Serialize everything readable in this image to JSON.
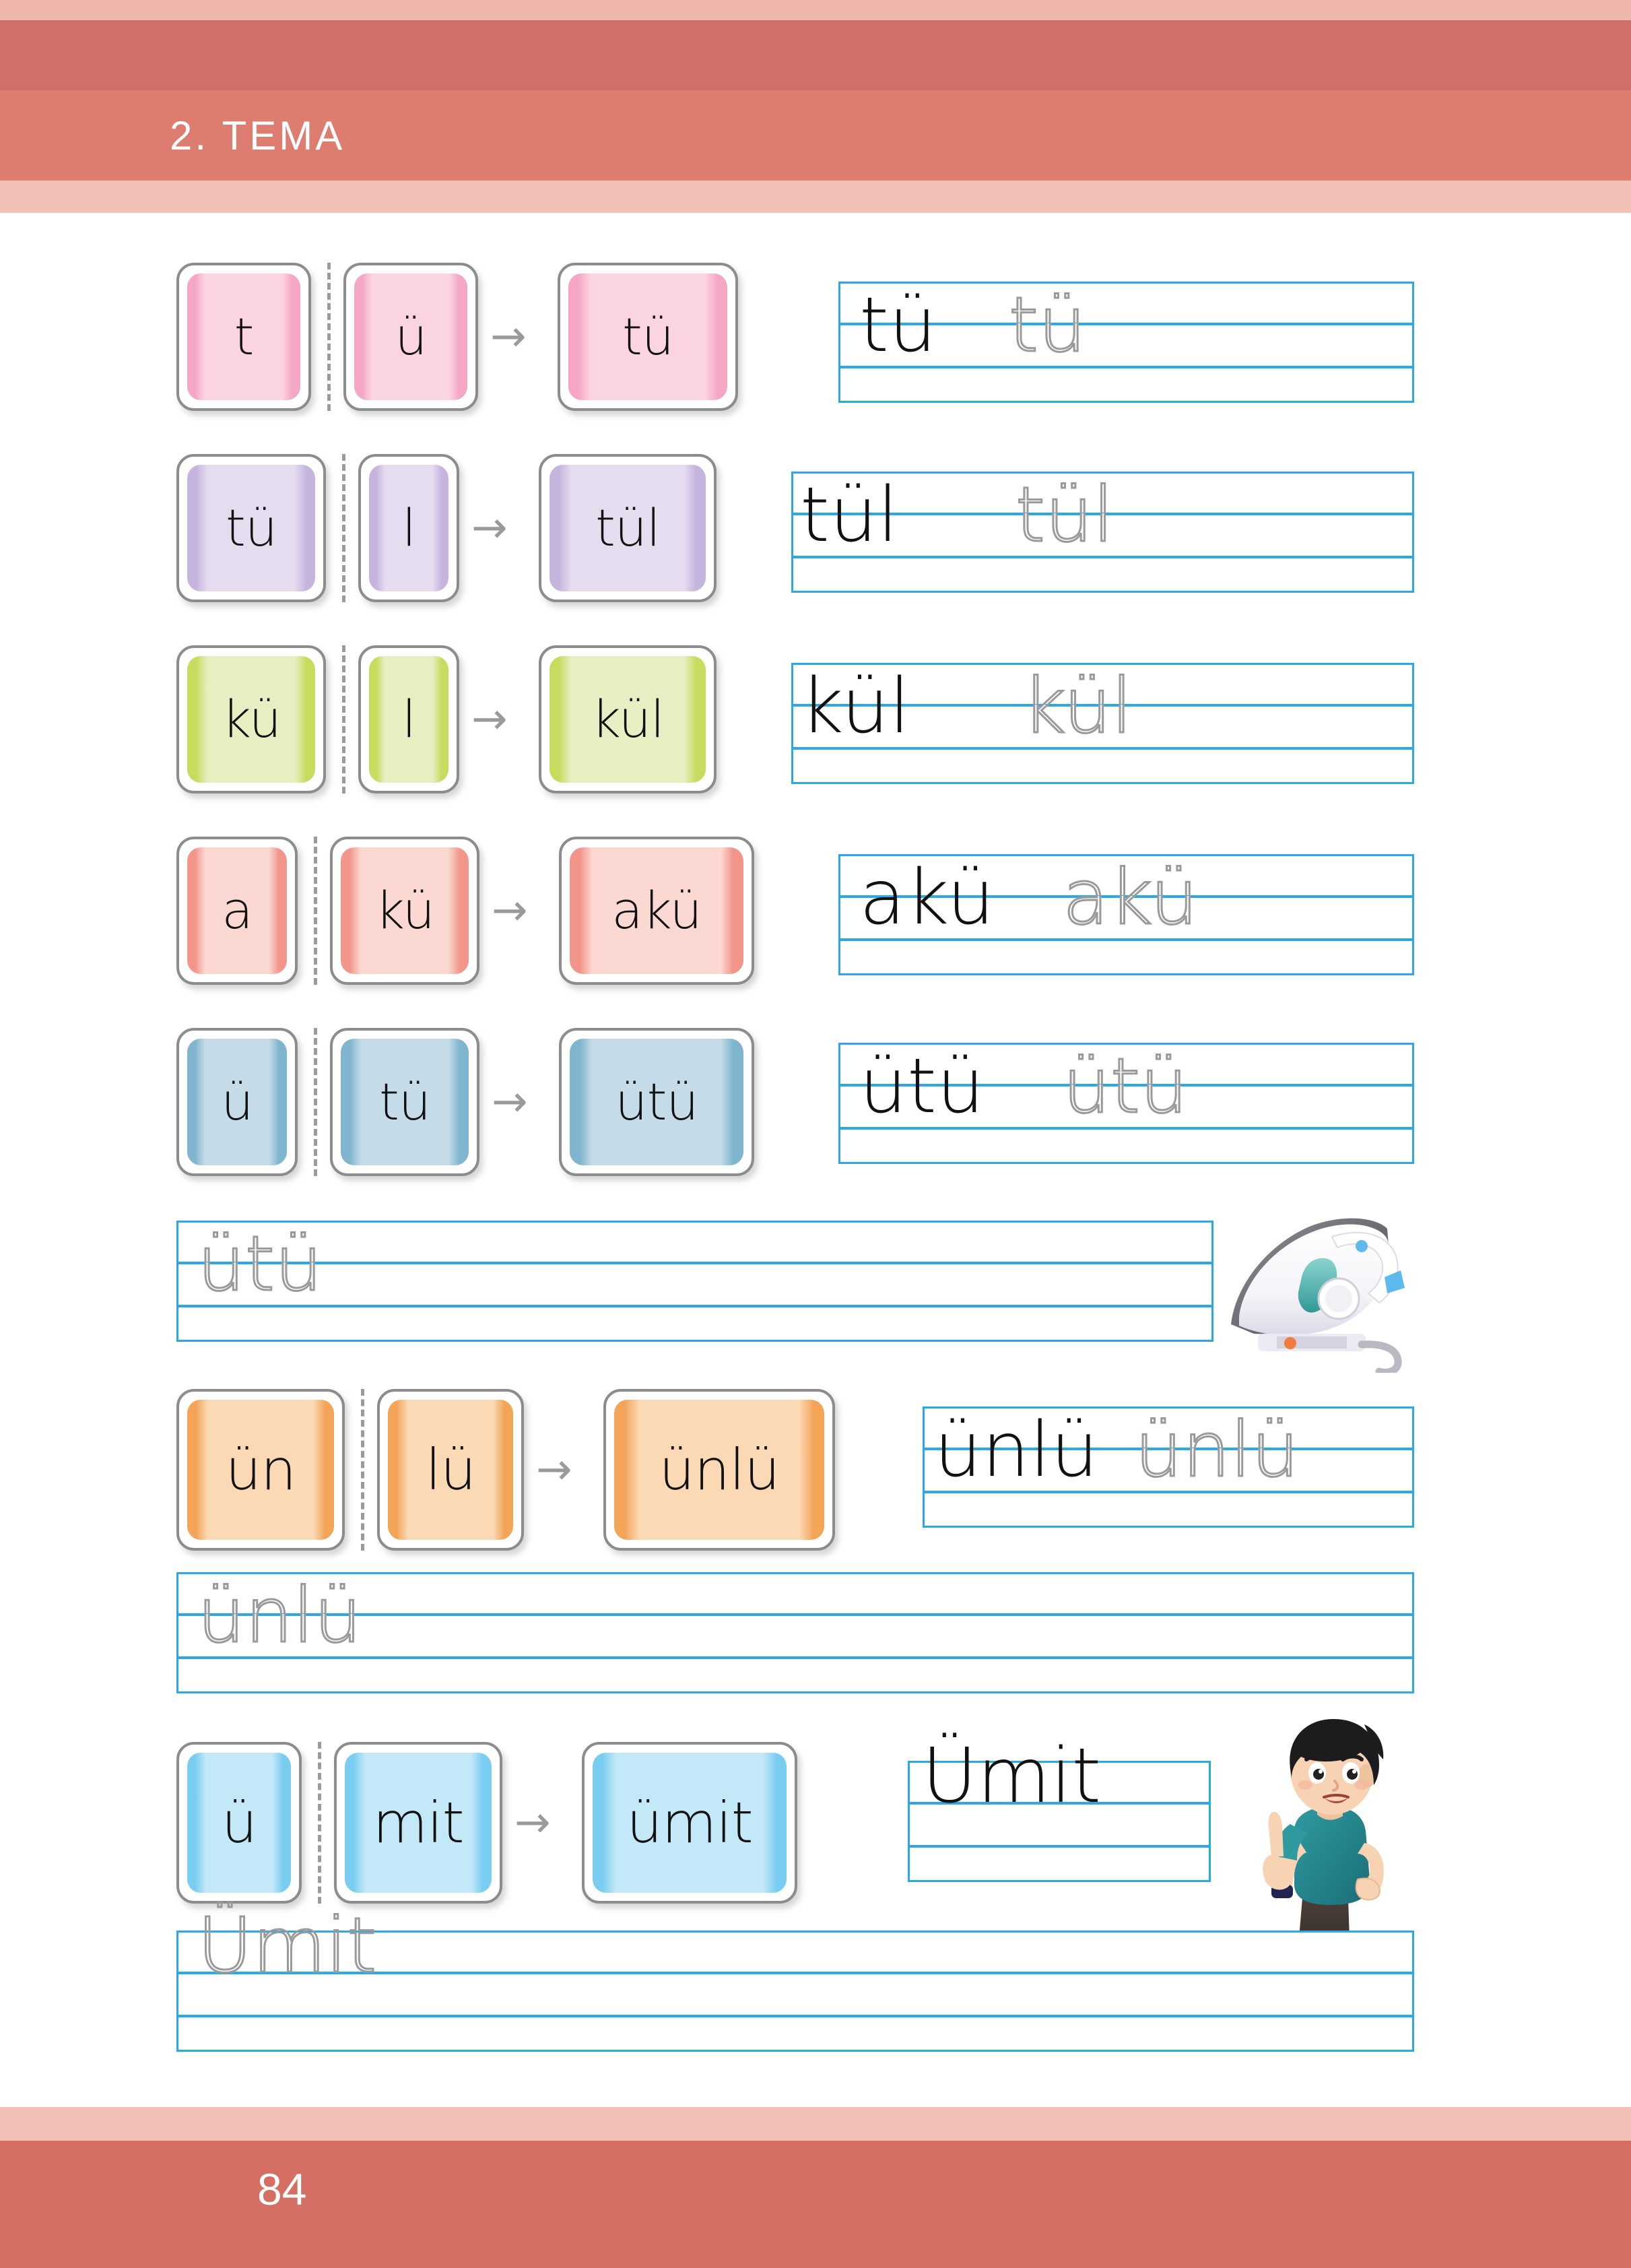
{
  "page": {
    "theme_label": "2.  TEMA",
    "page_number": "84",
    "colors": {
      "header_band": "#d56f64",
      "header_strip": "#f3c0b7",
      "rule_blue": "#2aa8e8",
      "trace_gray": "#9a9a9a",
      "card_border": "#8c8c8c",
      "arrow_gray": "#9a9a9a"
    }
  },
  "exercises": [
    {
      "id": "tu",
      "parts": [
        "t",
        "ü"
      ],
      "result": "tü",
      "color_fill": "#fbd4e2",
      "color_edge": "#f4a6c4",
      "write_solid": "tü",
      "write_trace": "tü"
    },
    {
      "id": "tul",
      "parts": [
        "tü",
        "l"
      ],
      "result": "tül",
      "color_fill": "#e5dcf0",
      "color_edge": "#c5b4de",
      "write_solid": "tül",
      "write_trace": "tül"
    },
    {
      "id": "kul",
      "parts": [
        "kü",
        "l"
      ],
      "result": "kül",
      "color_fill": "#e6efc2",
      "color_edge": "#c6dc5e",
      "write_solid": "kül",
      "write_trace": "kül"
    },
    {
      "id": "aku",
      "parts": [
        "a",
        "kü"
      ],
      "result": "akü",
      "color_fill": "#fbd9d2",
      "color_edge": "#f2958a",
      "write_solid": "akü",
      "write_trace": "akü"
    },
    {
      "id": "utu",
      "parts": [
        "ü",
        "tü"
      ],
      "result": "ütü",
      "color_fill": "#c5dce8",
      "color_edge": "#7fb5ce",
      "write_solid": "ütü",
      "write_trace": "ütü"
    },
    {
      "id": "unlu",
      "parts": [
        "ün",
        "lü"
      ],
      "result": "ünlü",
      "color_fill": "#fbd9b5",
      "color_edge": "#f3a457",
      "write_solid": "ünlü",
      "write_trace": "ünlü"
    },
    {
      "id": "umit",
      "parts": [
        "ü",
        "mit"
      ],
      "result": "ümit",
      "color_fill": "#c3e8f8",
      "color_edge": "#79cdf0",
      "write_solid": "Ümit",
      "write_trace": ""
    }
  ],
  "practice_lines": [
    {
      "id": "practice-utu",
      "trace": "ütü"
    },
    {
      "id": "practice-unlu",
      "trace": "ünlü"
    },
    {
      "id": "practice-umit",
      "trace": "Ümit"
    }
  ],
  "illustrations": [
    {
      "id": "iron-photo",
      "name": "clothes-iron-image",
      "alt": "ütü"
    },
    {
      "id": "boy-photo",
      "name": "boy-pointing-image",
      "alt": "Ümit"
    }
  ],
  "arrow_glyph": "→"
}
